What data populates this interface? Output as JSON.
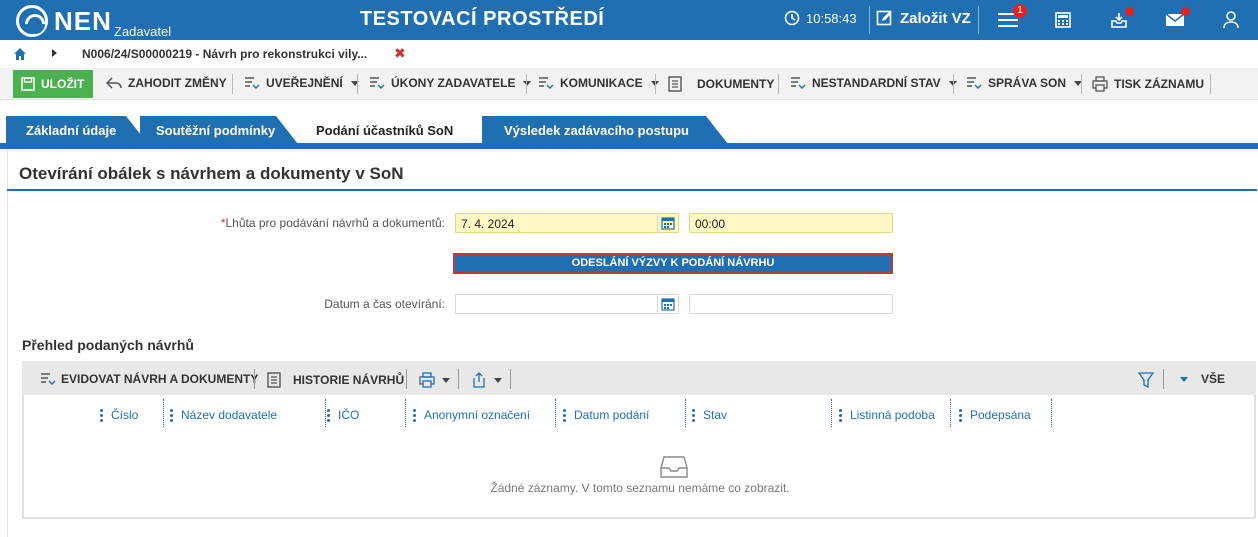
{
  "header": {
    "logo_text": "NEN",
    "logo_sub": "Zadavatel",
    "env_title": "TESTOVACÍ PROSTŘEDÍ",
    "clock": "10:58:43",
    "create_label": "Založit VZ",
    "menu_badge": "1",
    "brand_color": "#1f6fb2",
    "icons": [
      "clock-icon",
      "edit-icon",
      "menu-icon",
      "calculator-icon",
      "inbox-icon",
      "mail-icon",
      "user-icon"
    ]
  },
  "breadcrumb": {
    "path": "N006/24/S00000219 - Návrh pro rekonstrukci vily..."
  },
  "toolbar": {
    "save": "ULOŽIT",
    "discard": "ZAHODIT ZMĚNY",
    "publish": "UVEŘEJNĚNÍ",
    "actions": "ÚKONY ZADAVATELE",
    "communication": "KOMUNIKACE",
    "documents": "DOKUMENTY",
    "nonstandard": "NESTANDARDNÍ STAV",
    "son": "SPRÁVA SON",
    "print": "TISK ZÁZNAMU"
  },
  "tabs": [
    {
      "label": "Základní údaje"
    },
    {
      "label": "Soutěžní podmínky"
    },
    {
      "label": "Podání účastníků SoN"
    },
    {
      "label": "Výsledek zadávacího postupu"
    }
  ],
  "section": {
    "title": "Otevírání obálek s návrhem a dokumenty v SoN",
    "deadline_label": "Lhůta pro podávání návrhů a dokumentů:",
    "deadline_date": "7. 4. 2024",
    "deadline_time": "00:00",
    "send_button": "ODESLÁNÍ VÝZVY K PODÁNÍ NÁVRHU",
    "opening_label": "Datum a čas otevírání:",
    "opening_date": "",
    "opening_time": ""
  },
  "grid": {
    "title": "Přehled podaných návrhů",
    "record_button": "EVIDOVAT NÁVRH A DOKUMENTY",
    "history_button": "HISTORIE NÁVRHŮ",
    "filter_all": "VŠE",
    "columns": [
      "Číslo",
      "Název dodavatele",
      "IČO",
      "Anonymní označení",
      "Datum podání",
      "Stav",
      "Listinná podoba",
      "Podepsána"
    ],
    "empty_text": "Žádné záznamy. V tomto seznamu nemáme co zobrazit."
  }
}
